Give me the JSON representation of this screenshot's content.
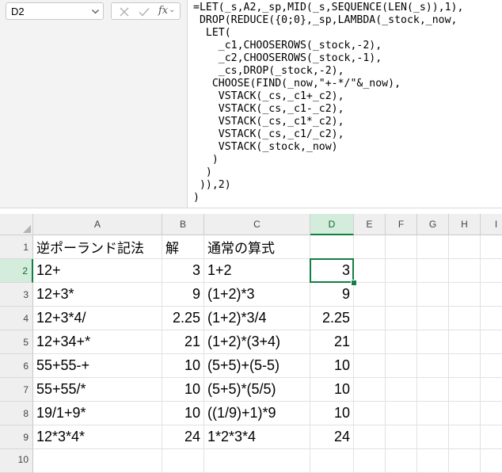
{
  "name_box": {
    "value": "D2"
  },
  "formula_bar": {
    "fx_label": "fx",
    "formula": "=LET(_s,A2,_sp,MID(_s,SEQUENCE(LEN(_s)),1),\n DROP(REDUCE({0;0},_sp,LAMBDA(_stock,_now,\n  LET(\n    _c1,CHOOSEROWS(_stock,-2),\n    _c2,CHOOSEROWS(_stock,-1),\n    _cs,DROP(_stock,-2),\n   CHOOSE(FIND(_now,\"+-*/\"&_now),\n    VSTACK(_cs,_c1+_c2),\n    VSTACK(_cs,_c1-_c2),\n    VSTACK(_cs,_c1*_c2),\n    VSTACK(_cs,_c1/_c2),\n    VSTACK(_stock,_now)\n   )\n  )\n )),2)\n)"
  },
  "sheet": {
    "columns": [
      "A",
      "B",
      "C",
      "D",
      "E",
      "F",
      "G",
      "H",
      "I"
    ],
    "active_column": "D",
    "active_row": "2",
    "rows": [
      {
        "num": "1",
        "a": "逆ポーランド記法",
        "b": "解",
        "c": "通常の算式",
        "d": ""
      },
      {
        "num": "2",
        "a": "12+",
        "b": "3",
        "c": "1+2",
        "d": "3"
      },
      {
        "num": "3",
        "a": "12+3*",
        "b": "9",
        "c": "(1+2)*3",
        "d": "9"
      },
      {
        "num": "4",
        "a": "12+3*4/",
        "b": "2.25",
        "c": "(1+2)*3/4",
        "d": "2.25"
      },
      {
        "num": "5",
        "a": "12+34+*",
        "b": "21",
        "c": "(1+2)*(3+4)",
        "d": "21"
      },
      {
        "num": "6",
        "a": "55+55-+",
        "b": "10",
        "c": "(5+5)+(5-5)",
        "d": "10"
      },
      {
        "num": "7",
        "a": "55+55/*",
        "b": "10",
        "c": "(5+5)*(5/5)",
        "d": "10"
      },
      {
        "num": "8",
        "a": "19/1+9*",
        "b": "10",
        "c": "((1/9)+1)*9",
        "d": "10"
      },
      {
        "num": "9",
        "a": "12*3*4*",
        "b": "24",
        "c": "1*2*3*4",
        "d": "24"
      },
      {
        "num": "10",
        "a": "",
        "b": "",
        "c": "",
        "d": ""
      }
    ]
  },
  "colors": {
    "accent": "#137e43",
    "header_active": "#d3ecdb"
  }
}
